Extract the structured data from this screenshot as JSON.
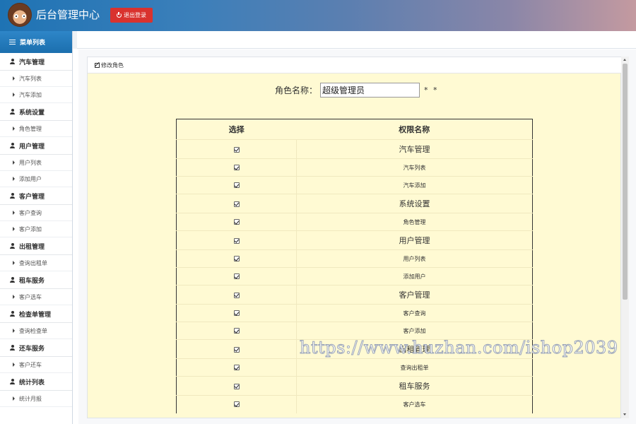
{
  "header": {
    "title": "后台管理中心",
    "logout_label": "退出登录"
  },
  "sidebar": {
    "menu_title": "菜单列表",
    "groups": [
      {
        "label": "汽车管理",
        "items": [
          "汽车列表",
          "汽车添加"
        ]
      },
      {
        "label": "系统设置",
        "items": [
          "角色管理"
        ]
      },
      {
        "label": "用户管理",
        "items": [
          "用户列表",
          "添加用户"
        ]
      },
      {
        "label": "客户管理",
        "items": [
          "客户查询",
          "客户添加"
        ]
      },
      {
        "label": "出租管理",
        "items": [
          "查询出租单"
        ]
      },
      {
        "label": "租车服务",
        "items": [
          "客户选车"
        ]
      },
      {
        "label": "检查单管理",
        "items": [
          "查询检查单"
        ]
      },
      {
        "label": "还车服务",
        "items": [
          "客户还车"
        ]
      },
      {
        "label": "统计列表",
        "items": [
          "统计月报"
        ]
      }
    ]
  },
  "panel": {
    "title": "修改角色",
    "role_label": "角色名称：",
    "role_value": "超级管理员",
    "required_mark": "* *"
  },
  "permissions_table": {
    "headers": [
      "选择",
      "权限名称"
    ],
    "rows": [
      {
        "name": "汽车管理",
        "level": "group",
        "checked": true
      },
      {
        "name": "汽车列表",
        "level": "item",
        "checked": true
      },
      {
        "name": "汽车添加",
        "level": "item",
        "checked": true
      },
      {
        "name": "系统设置",
        "level": "group",
        "checked": true
      },
      {
        "name": "角色管理",
        "level": "item",
        "checked": true
      },
      {
        "name": "用户管理",
        "level": "group",
        "checked": true
      },
      {
        "name": "用户列表",
        "level": "item",
        "checked": true
      },
      {
        "name": "添加用户",
        "level": "item",
        "checked": true
      },
      {
        "name": "客户管理",
        "level": "group",
        "checked": true
      },
      {
        "name": "客户查询",
        "level": "item",
        "checked": true
      },
      {
        "name": "客户添加",
        "level": "item",
        "checked": true
      },
      {
        "name": "出租管理",
        "level": "group",
        "checked": true
      },
      {
        "name": "查询出租单",
        "level": "item",
        "checked": true
      },
      {
        "name": "租车服务",
        "level": "group",
        "checked": true
      },
      {
        "name": "客户选车",
        "level": "item",
        "checked": true
      }
    ]
  },
  "watermark": "https://www.huzhan.com/ishop2039",
  "colors": {
    "header_start": "#1e73b4",
    "header_end": "#c49aa0",
    "logout_button": "#d9322e",
    "panel_background": "#fffad3"
  }
}
